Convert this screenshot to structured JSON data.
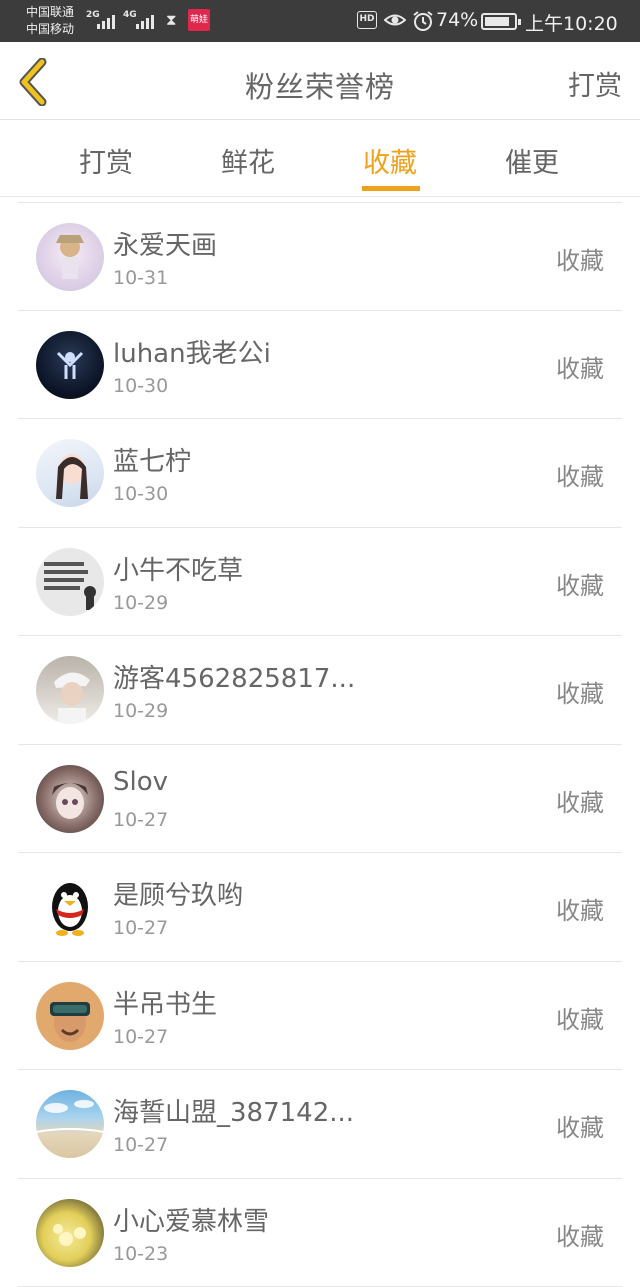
{
  "statusbar": {
    "carrier1": "中国联通",
    "carrier2": "中国移动",
    "net1": "2G",
    "net2": "4G",
    "hd": "HD",
    "battery": "74%",
    "time": "上午10:20",
    "app_badge": "萌娃"
  },
  "header": {
    "title": "粉丝荣誉榜",
    "action": "打赏"
  },
  "tabs": [
    "打赏",
    "鲜花",
    "收藏",
    "催更"
  ],
  "active_tab": 2,
  "accent": "#f0a21c",
  "rows": [
    {
      "name": "永爱天画",
      "date": "10-31",
      "action": "收藏"
    },
    {
      "name": "luhan我老公i",
      "date": "10-30",
      "action": "收藏"
    },
    {
      "name": "蓝七柠",
      "date": "10-30",
      "action": "收藏"
    },
    {
      "name": "小牛不吃草",
      "date": "10-29",
      "action": "收藏"
    },
    {
      "name": "游客4562825817...",
      "date": "10-29",
      "action": "收藏"
    },
    {
      "name": "Slov",
      "date": "10-27",
      "action": "收藏"
    },
    {
      "name": "是顾兮玖哟",
      "date": "10-27",
      "action": "收藏"
    },
    {
      "name": "半吊书生",
      "date": "10-27",
      "action": "收藏"
    },
    {
      "name": "海誓山盟_387142...",
      "date": "10-27",
      "action": "收藏"
    },
    {
      "name": "小心爱慕林雪",
      "date": "10-23",
      "action": "收藏"
    }
  ]
}
